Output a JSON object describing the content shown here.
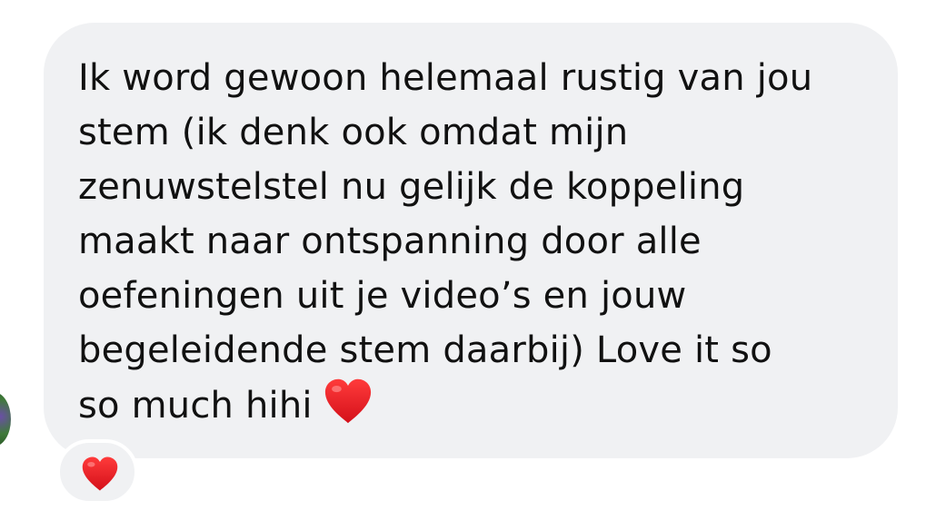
{
  "message": {
    "lines": [
      "Ik word gewoon helemaal rustig van jou",
      "stem (ik denk ook omdat mijn",
      "zenuwstelstel nu gelijk de koppeling",
      "maakt naar ontspanning door alle",
      "oefeningen uit je video’s en jouw",
      "begeleidende stem daarbij) Love it so",
      "so much hihi"
    ],
    "trailing_emoji": "red-heart",
    "bubble_color": "#f0f1f3",
    "text_color": "#111111"
  },
  "reaction": {
    "emoji": "red-heart",
    "heart_color": "#e0151f"
  }
}
